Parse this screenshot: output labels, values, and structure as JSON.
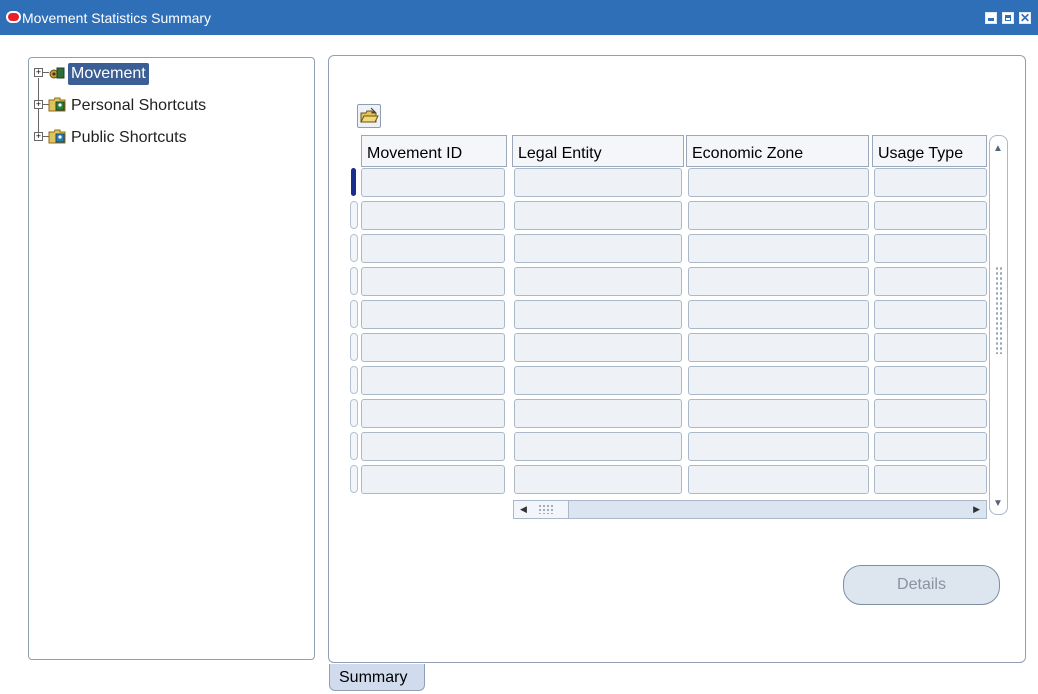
{
  "window": {
    "title": "Movement Statistics Summary",
    "minimize_glyph": "▁",
    "maximize_glyph": "□",
    "close_glyph": "✕"
  },
  "navigator": {
    "items": [
      {
        "label": "Movement",
        "icon": "movement-icon",
        "selected": true
      },
      {
        "label": "Personal Shortcuts",
        "icon": "personal-shortcuts-folder-icon",
        "selected": false
      },
      {
        "label": "Public Shortcuts",
        "icon": "public-shortcuts-folder-icon",
        "selected": false
      }
    ]
  },
  "toolbar": {
    "open_icon": "folder-open-icon"
  },
  "table": {
    "columns": [
      "Movement ID",
      "Legal Entity",
      "Economic Zone",
      "Usage Type"
    ],
    "row_count": 10,
    "current_row": 1
  },
  "buttons": {
    "details_label": "Details"
  },
  "tabs": {
    "summary_label": "Summary"
  },
  "colors": {
    "titlebar": "#2e6fb8",
    "selection": "#3b5f94",
    "current_row_indicator": "#1a2f8c",
    "cell_fill": "#eef2f7",
    "tab_fill": "#d0dced"
  }
}
